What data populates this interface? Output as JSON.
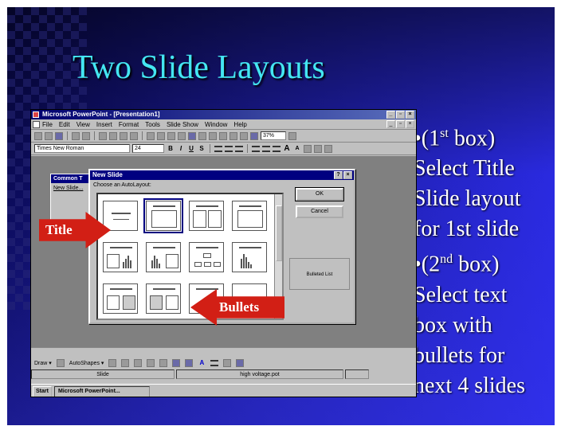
{
  "slide": {
    "title": "Two Slide Layouts",
    "bullets": [
      {
        "prefix": "•(1",
        "sup": "st",
        "suffix": " box)"
      },
      {
        "text": "Select Title"
      },
      {
        "text": "Slide layout"
      },
      {
        "text": "for 1st slide"
      },
      {
        "prefix": "•(2",
        "sup": "nd",
        "suffix": " box)"
      },
      {
        "text": "Select text"
      },
      {
        "text": "box with"
      },
      {
        "text": "bullets for"
      },
      {
        "text": "next 4 slides"
      }
    ]
  },
  "window": {
    "title": "Microsoft PowerPoint - [Presentation1]",
    "menu": [
      "File",
      "Edit",
      "View",
      "Insert",
      "Format",
      "Tools",
      "Slide Show",
      "Window",
      "Help"
    ],
    "zoom": "37%",
    "font": "Times New Roman",
    "font_size": "24",
    "format_buttons": [
      "B",
      "I",
      "U",
      "S"
    ],
    "common_tasks_title": "Common T",
    "common_tasks_item": "New Slide..."
  },
  "dialog": {
    "title": "New Slide",
    "choose_label": "Choose an AutoLayout:",
    "ok_label": "OK",
    "cancel_label": "Cancel",
    "preview_label": "Bulleted List"
  },
  "callouts": {
    "title_arrow": "Title",
    "bullets_arrow": "Bullets"
  },
  "drawbar": {
    "draw_label": "Draw ▾",
    "autoshapes_label": "AutoShapes ▾"
  },
  "statusbar": {
    "slide_label": "Slide",
    "design_label": "high voltage.pot"
  },
  "taskbar": {
    "start_label": "Start",
    "task_label": "Microsoft PowerPoint..."
  },
  "colors": {
    "title": "#44e6f2",
    "callout": "#d21f15",
    "dialog_title": "#000080"
  }
}
